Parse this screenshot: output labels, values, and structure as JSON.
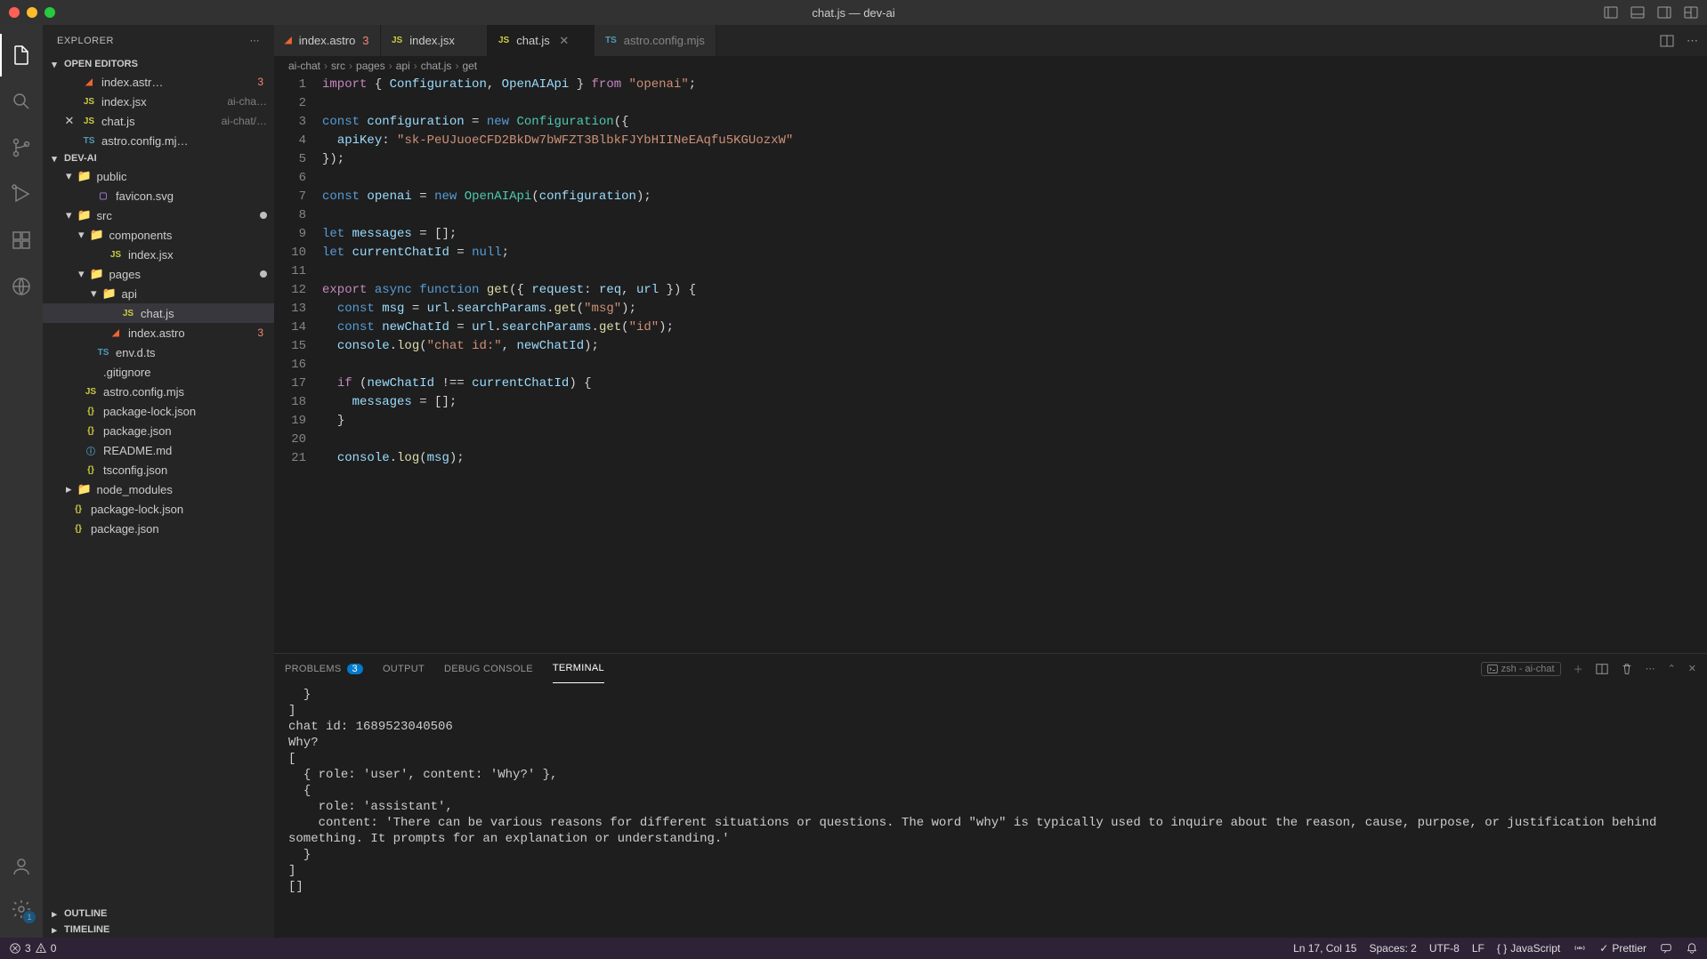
{
  "window": {
    "title": "chat.js — dev-ai"
  },
  "activity": {
    "badge": "1"
  },
  "sidebar": {
    "title": "EXPLORER",
    "openEditors": "OPEN EDITORS",
    "project": "DEV-AI",
    "outline": "OUTLINE",
    "timeline": "TIMELINE",
    "editors": [
      {
        "name": "index.astr…",
        "err": "3"
      },
      {
        "name": "index.jsx",
        "suffix": "ai-cha…"
      },
      {
        "name": "chat.js",
        "suffix": "ai-chat/…"
      },
      {
        "name": "astro.config.mj…",
        "suffix": ""
      }
    ],
    "tree": [
      {
        "depth": 1,
        "kind": "folder",
        "name": "public",
        "open": true
      },
      {
        "depth": 2,
        "kind": "file",
        "name": "favicon.svg",
        "ficon": "svg"
      },
      {
        "depth": 1,
        "kind": "folder",
        "name": "src",
        "open": true,
        "mod": true
      },
      {
        "depth": 2,
        "kind": "folder",
        "name": "components",
        "open": true
      },
      {
        "depth": 3,
        "kind": "file",
        "name": "index.jsx",
        "ficon": "js"
      },
      {
        "depth": 2,
        "kind": "folder",
        "name": "pages",
        "open": true,
        "mod": true
      },
      {
        "depth": 3,
        "kind": "folder",
        "name": "api",
        "open": true
      },
      {
        "depth": 4,
        "kind": "file",
        "name": "chat.js",
        "ficon": "js",
        "sel": true
      },
      {
        "depth": 3,
        "kind": "file",
        "name": "index.astro",
        "ficon": "astro",
        "err": "3"
      },
      {
        "depth": 2,
        "kind": "file",
        "name": "env.d.ts",
        "ficon": "ts"
      },
      {
        "depth": 1,
        "kind": "file",
        "name": ".gitignore",
        "ficon": ""
      },
      {
        "depth": 1,
        "kind": "file",
        "name": "astro.config.mjs",
        "ficon": "js"
      },
      {
        "depth": 1,
        "kind": "file",
        "name": "package-lock.json",
        "ficon": "json"
      },
      {
        "depth": 1,
        "kind": "file",
        "name": "package.json",
        "ficon": "json"
      },
      {
        "depth": 1,
        "kind": "file",
        "name": "README.md",
        "ficon": "md"
      },
      {
        "depth": 1,
        "kind": "file",
        "name": "tsconfig.json",
        "ficon": "json"
      },
      {
        "depth": 1,
        "kind": "folder",
        "name": "node_modules",
        "open": false
      },
      {
        "depth": 0,
        "kind": "file",
        "name": "package-lock.json",
        "ficon": "json"
      },
      {
        "depth": 0,
        "kind": "file",
        "name": "package.json",
        "ficon": "json"
      }
    ]
  },
  "tabs": [
    {
      "name": "index.astro",
      "err": "3",
      "ficon": "astro"
    },
    {
      "name": "index.jsx",
      "ficon": "js"
    },
    {
      "name": "chat.js",
      "ficon": "js",
      "active": true,
      "close": true
    },
    {
      "name": "astro.config.mjs",
      "ficon": "ts",
      "dim": true
    }
  ],
  "breadcrumb": [
    "ai-chat",
    "src",
    "pages",
    "api",
    "chat.js",
    "get"
  ],
  "code": [
    {
      "n": 1,
      "h": "<span class='kw2'>import</span> <span class='pn'>{</span> <span class='id'>Configuration</span><span class='pn'>,</span> <span class='id'>OpenAIApi</span> <span class='pn'>}</span> <span class='kw2'>from</span> <span class='str'>\"openai\"</span><span class='pn'>;</span>"
    },
    {
      "n": 2,
      "h": ""
    },
    {
      "n": 3,
      "h": "<span class='kw'>const</span> <span class='id'>configuration</span> <span class='op'>=</span> <span class='kw'>new</span> <span class='cls'>Configuration</span><span class='pn'>({</span>"
    },
    {
      "n": 4,
      "h": "  <span class='id'>apiKey</span><span class='pn'>:</span> <span class='str'>\"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\"</span>"
    },
    {
      "n": 5,
      "h": "<span class='pn'>});</span>"
    },
    {
      "n": 6,
      "h": ""
    },
    {
      "n": 7,
      "h": "<span class='kw'>const</span> <span class='id'>openai</span> <span class='op'>=</span> <span class='kw'>new</span> <span class='cls'>OpenAIApi</span><span class='pn'>(</span><span class='id'>configuration</span><span class='pn'>);</span>"
    },
    {
      "n": 8,
      "h": ""
    },
    {
      "n": 9,
      "h": "<span class='kw'>let</span> <span class='id'>messages</span> <span class='op'>=</span> <span class='pn'>[];</span>"
    },
    {
      "n": 10,
      "h": "<span class='kw'>let</span> <span class='id'>currentChatId</span> <span class='op'>=</span> <span class='kw'>null</span><span class='pn'>;</span>"
    },
    {
      "n": 11,
      "h": ""
    },
    {
      "n": 12,
      "h": "<span class='kw2'>export</span> <span class='kw'>async</span> <span class='kw'>function</span> <span class='fn'>get</span><span class='pn'>({</span> <span class='id'>request</span><span class='pn'>:</span> <span class='id'>req</span><span class='pn'>,</span> <span class='id'>url</span> <span class='pn'>}) {</span>"
    },
    {
      "n": 13,
      "h": "  <span class='kw'>const</span> <span class='id'>msg</span> <span class='op'>=</span> <span class='id'>url</span><span class='pn'>.</span><span class='id'>searchParams</span><span class='pn'>.</span><span class='fn'>get</span><span class='pn'>(</span><span class='str'>\"msg\"</span><span class='pn'>);</span>"
    },
    {
      "n": 14,
      "h": "  <span class='kw'>const</span> <span class='id'>newChatId</span> <span class='op'>=</span> <span class='id'>url</span><span class='pn'>.</span><span class='id'>searchParams</span><span class='pn'>.</span><span class='fn'>get</span><span class='pn'>(</span><span class='str'>\"id\"</span><span class='pn'>);</span>"
    },
    {
      "n": 15,
      "h": "  <span class='id'>console</span><span class='pn'>.</span><span class='fn'>log</span><span class='pn'>(</span><span class='str'>\"chat id:\"</span><span class='pn'>,</span> <span class='id'>newChatId</span><span class='pn'>);</span>"
    },
    {
      "n": 16,
      "h": ""
    },
    {
      "n": 17,
      "h": "  <span class='kw2'>if</span> <span class='pn'>(</span><span class='id'>newChatId</span> <span class='op'>!==</span> <span class='id'>currentChatId</span><span class='pn'>) {</span>"
    },
    {
      "n": 18,
      "h": "    <span class='id'>messages</span> <span class='op'>=</span> <span class='pn'>[];</span>"
    },
    {
      "n": 19,
      "h": "  <span class='pn'>}</span>"
    },
    {
      "n": 20,
      "h": ""
    },
    {
      "n": 21,
      "h": "  <span class='id'>console</span><span class='pn'>.</span><span class='fn'>log</span><span class='pn'>(</span><span class='id'>msg</span><span class='pn'>);</span>"
    }
  ],
  "panel": {
    "tabs": {
      "problems": "PROBLEMS",
      "problemsCount": "3",
      "output": "OUTPUT",
      "debug": "DEBUG CONSOLE",
      "terminal": "TERMINAL"
    },
    "termLabel": "zsh - ai-chat",
    "terminal": "  }\n]\nchat id: 1689523040506\nWhy?\n[\n  { role: 'user', content: 'Why?' },\n  {\n    role: 'assistant',\n    content: 'There can be various reasons for different situations or questions. The word \"why\" is typically used to inquire about the reason, cause, purpose, or justification behind something. It prompts for an explanation or understanding.'\n  }\n]\n[]"
  },
  "status": {
    "errors": "3",
    "warnings": "0",
    "ln": "Ln 17, Col 15",
    "spaces": "Spaces: 2",
    "enc": "UTF-8",
    "eol": "LF",
    "lang": "JavaScript",
    "prettier": "Prettier"
  }
}
